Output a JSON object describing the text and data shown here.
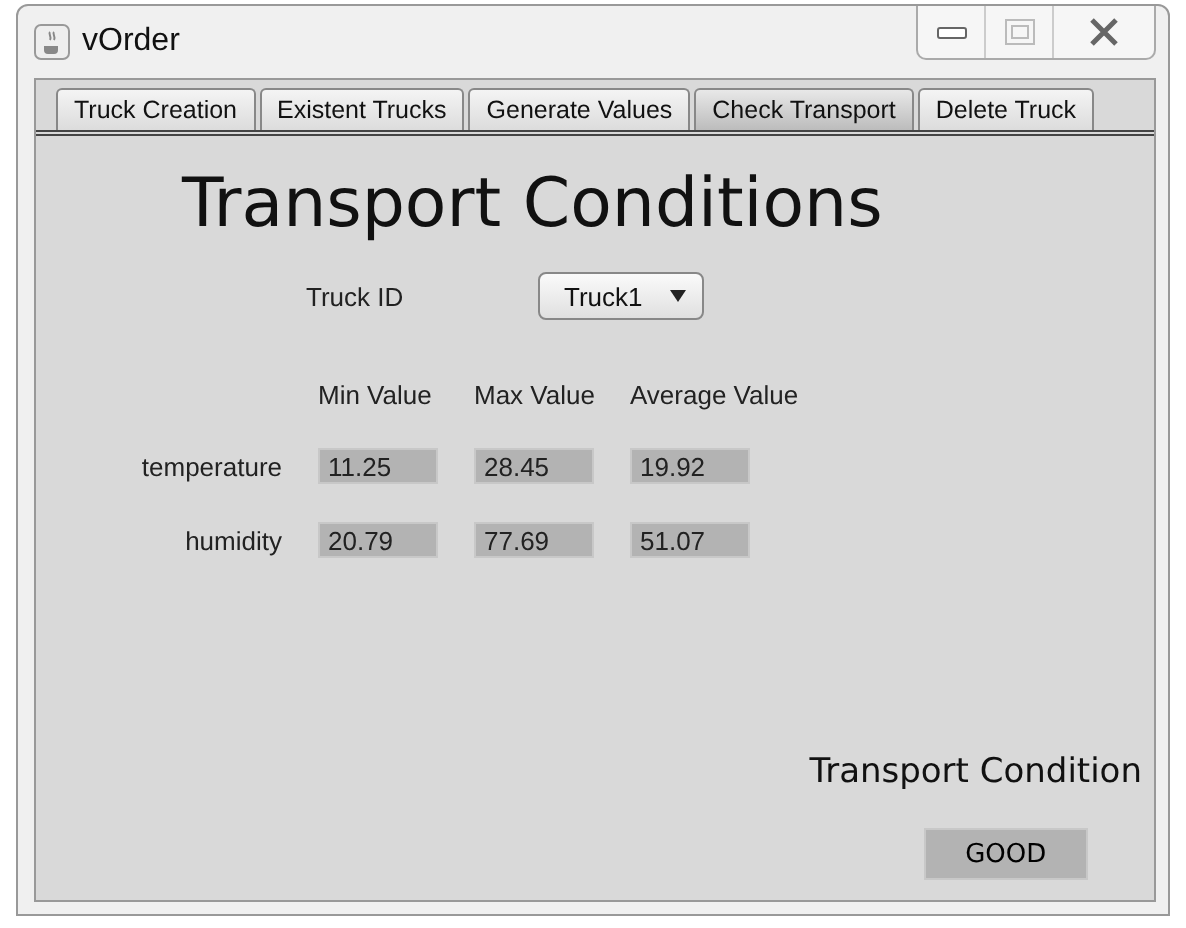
{
  "window": {
    "title": "vOrder"
  },
  "tabs": [
    {
      "label": "Truck Creation",
      "selected": false
    },
    {
      "label": "Existent Trucks",
      "selected": false
    },
    {
      "label": "Generate Values",
      "selected": false
    },
    {
      "label": "Check Transport",
      "selected": true
    },
    {
      "label": "Delete Truck",
      "selected": false
    }
  ],
  "heading": "Transport Conditions",
  "truck_id": {
    "label": "Truck ID",
    "value": "Truck1"
  },
  "table": {
    "columns": [
      "Min Value",
      "Max Value",
      "Average Value"
    ],
    "rows": [
      {
        "label": "temperature",
        "values": [
          "11.25",
          "28.45",
          "19.92"
        ]
      },
      {
        "label": "humidity",
        "values": [
          "20.79",
          "77.69",
          "51.07"
        ]
      }
    ]
  },
  "condition": {
    "label": "Transport Condition",
    "value": "GOOD"
  }
}
